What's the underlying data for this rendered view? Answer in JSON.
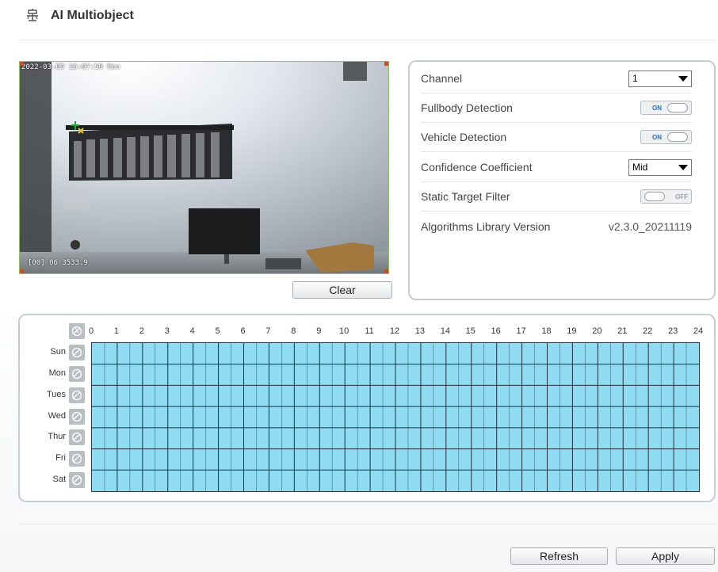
{
  "header": {
    "title": "AI Multiobject"
  },
  "video": {
    "timestamp": "2022-03-09 16:07:50 Mon",
    "channel_overlay": "[00] 06 3533.9"
  },
  "buttons": {
    "clear": "Clear",
    "refresh": "Refresh",
    "apply": "Apply"
  },
  "settings": {
    "channel": {
      "label": "Channel",
      "value": "1"
    },
    "fullbody": {
      "label": "Fullbody Detection",
      "state": "ON"
    },
    "vehicle": {
      "label": "Vehicle Detection",
      "state": "ON"
    },
    "confidence": {
      "label": "Confidence Coefficient",
      "value": "Mid"
    },
    "static_filter": {
      "label": "Static Target Filter",
      "state": "OFF"
    },
    "algo": {
      "label": "Algorithms Library Version",
      "value": "v2.3.0_20211119"
    }
  },
  "schedule": {
    "days": [
      "Sun",
      "Mon",
      "Tues",
      "Wed",
      "Thur",
      "Fri",
      "Sat"
    ],
    "hours": [
      "0",
      "1",
      "2",
      "3",
      "4",
      "5",
      "6",
      "7",
      "8",
      "9",
      "10",
      "11",
      "12",
      "13",
      "14",
      "15",
      "16",
      "17",
      "18",
      "19",
      "20",
      "21",
      "22",
      "23",
      "24"
    ],
    "fill_color": "#8edbf2",
    "all_selected": true
  },
  "colors": {
    "accent": "#2c6db5",
    "panel_border": "#c6ccd2",
    "grid_fill": "#8edbf2"
  }
}
